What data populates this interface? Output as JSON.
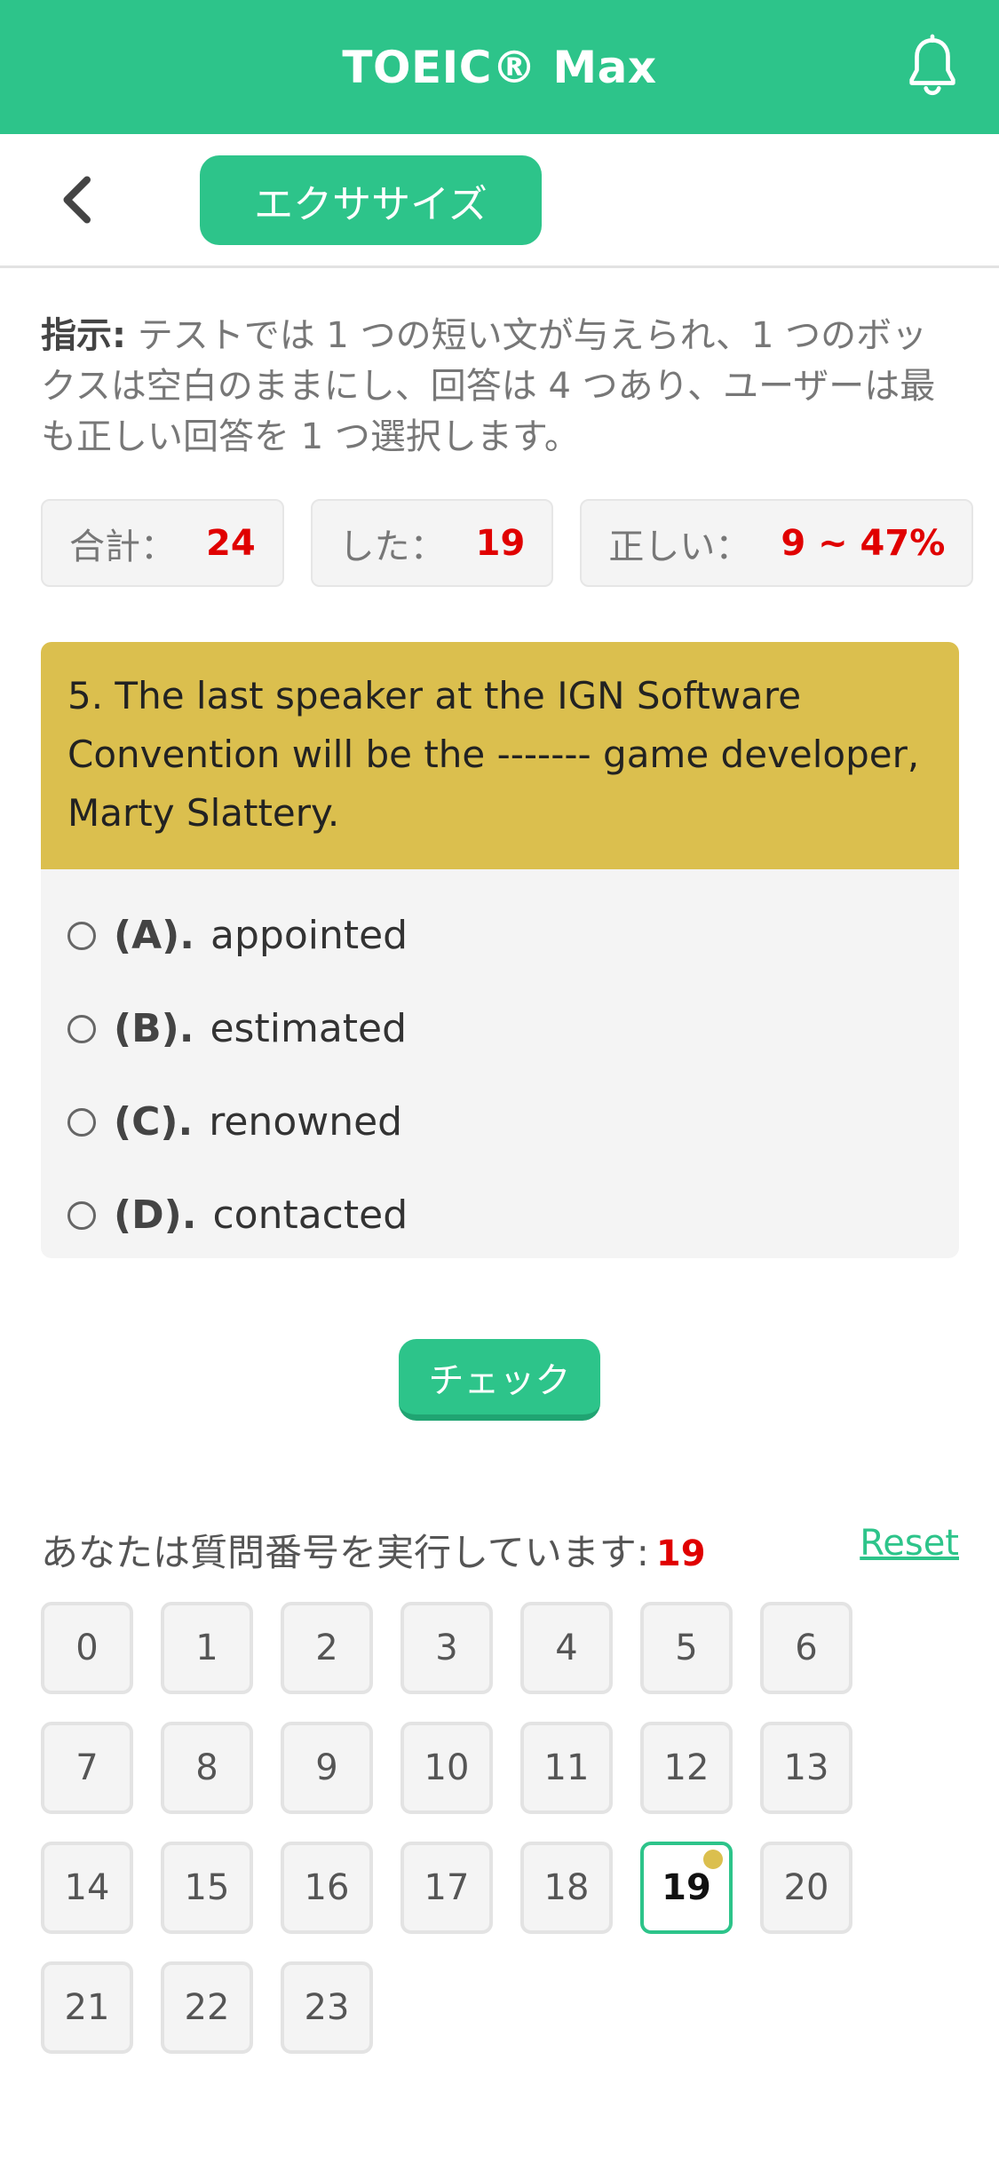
{
  "app": {
    "title": "TOEIC® Max"
  },
  "nav": {
    "tab_label": "エクササイズ"
  },
  "instructions": {
    "label": "指示:",
    "text": " テストでは 1 つの短い文が与えられ、1 つのボックスは空白のままにし、回答は 4 つあり、ユーザーは最も正しい回答を 1 つ選択します。"
  },
  "stats": [
    {
      "label": "合計：",
      "value": "24"
    },
    {
      "label": "した：",
      "value": "19"
    },
    {
      "label": "正しい：",
      "value": "9 ~ 47%"
    }
  ],
  "question": {
    "text": "5. The last speaker at the IGN Software Convention will be the ------- game developer, Marty Slattery.",
    "options": [
      {
        "letter": "(A).",
        "text": "appointed"
      },
      {
        "letter": "(B).",
        "text": "estimated"
      },
      {
        "letter": "(C).",
        "text": "renowned"
      },
      {
        "letter": "(D).",
        "text": "contacted"
      }
    ]
  },
  "check_label": "チェック",
  "progress": {
    "label": "あなたは質問番号を実行しています:",
    "current": "19",
    "reset_label": "Reset"
  },
  "question_numbers": [
    "0",
    "1",
    "2",
    "3",
    "4",
    "5",
    "6",
    "7",
    "8",
    "9",
    "10",
    "11",
    "12",
    "13",
    "14",
    "15",
    "16",
    "17",
    "18",
    "19",
    "20",
    "21",
    "22",
    "23"
  ],
  "colors": {
    "primary": "#2dc48a",
    "question_header": "#dbbf4e",
    "accent_red": "#e00000"
  },
  "icons": {
    "notification": "bell-icon",
    "back": "chevron-left-icon"
  }
}
